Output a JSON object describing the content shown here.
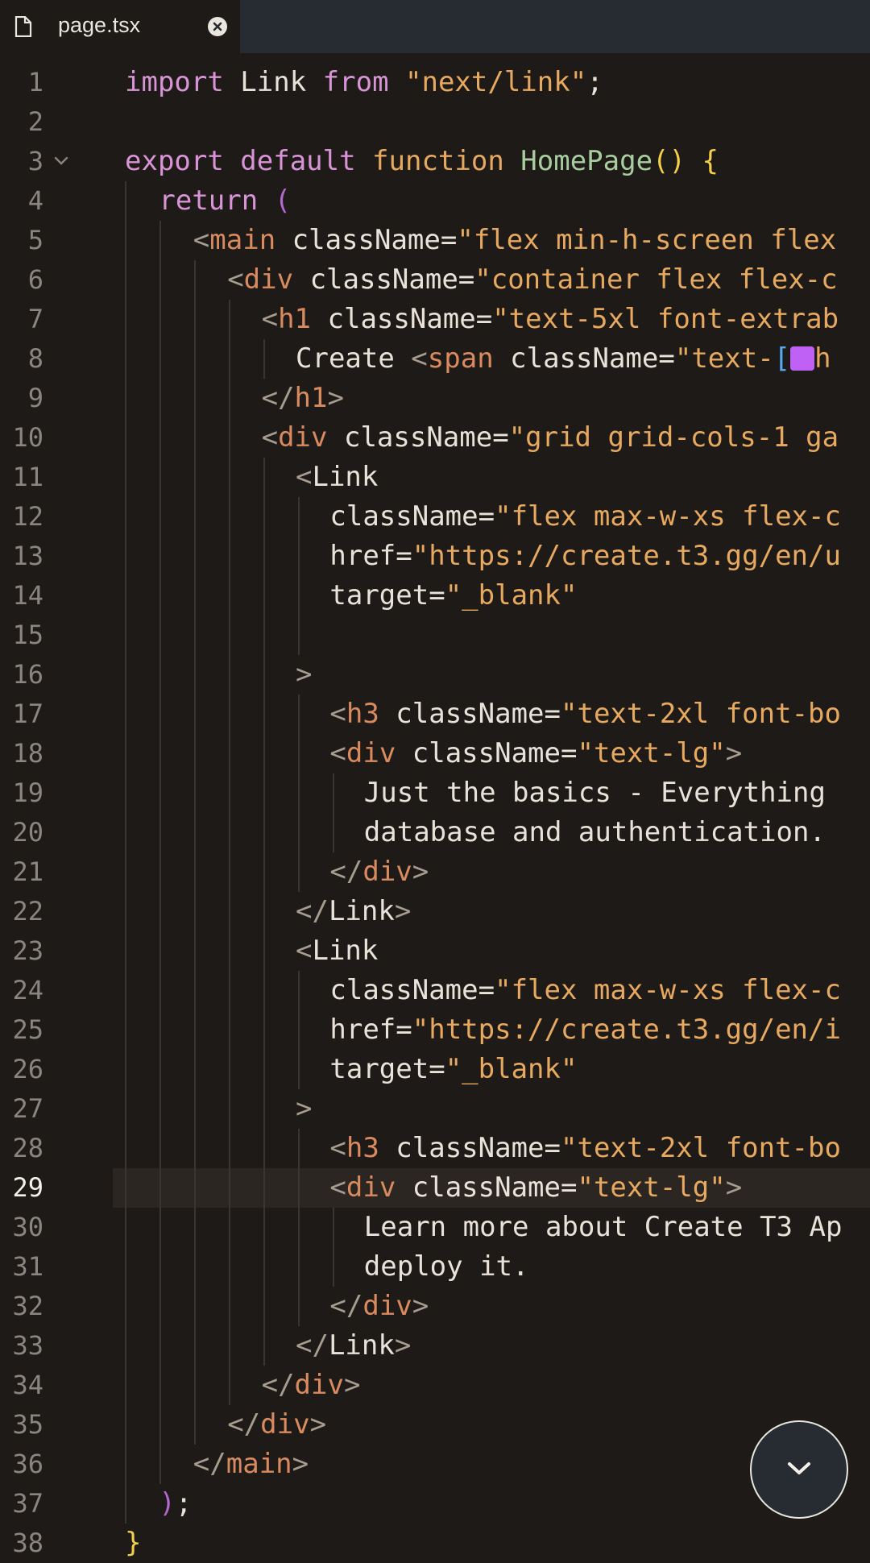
{
  "tab": {
    "title": "page.tsx"
  },
  "current_line": 29,
  "icons": {
    "file": "file-icon",
    "close": "close-icon",
    "scroll": "chevron-down-icon",
    "fold": "fold-chevron-icon"
  },
  "colors": {
    "background": "#1e1a17",
    "tab_bar": "#262c31",
    "keyword": "#d894d6",
    "string": "#e7a95f",
    "function": "#a8cd9f",
    "bracket": "#f2d04a",
    "swatch": "#c061f5"
  },
  "lines": [
    {
      "n": "1",
      "tokens": [
        {
          "c": "k",
          "t": "import"
        },
        {
          "c": "t",
          "t": " Link "
        },
        {
          "c": "k",
          "t": "from"
        },
        {
          "c": "s",
          "t": " \"next/link\""
        },
        {
          "c": "t",
          "t": ";"
        }
      ]
    },
    {
      "n": "2",
      "tokens": []
    },
    {
      "n": "3",
      "tokens": [
        {
          "c": "k",
          "t": "export default "
        },
        {
          "c": "s",
          "t": "function "
        },
        {
          "c": "f",
          "t": "HomePage"
        },
        {
          "c": "b",
          "t": "() {"
        }
      ]
    },
    {
      "n": "4",
      "tokens": [
        {
          "c": "k",
          "t": "return "
        },
        {
          "c": "m",
          "t": "("
        }
      ]
    },
    {
      "n": "5",
      "tokens": [
        {
          "c": "p",
          "t": "<"
        },
        {
          "c": "tag",
          "t": "main"
        },
        {
          "c": "t",
          "t": " className="
        },
        {
          "c": "s",
          "t": "\"flex min-h-screen flex"
        }
      ]
    },
    {
      "n": "6",
      "tokens": [
        {
          "c": "p",
          "t": "<"
        },
        {
          "c": "tag",
          "t": "div"
        },
        {
          "c": "t",
          "t": " className="
        },
        {
          "c": "s",
          "t": "\"container flex flex-c"
        }
      ]
    },
    {
      "n": "7",
      "tokens": [
        {
          "c": "p",
          "t": "<"
        },
        {
          "c": "tag",
          "t": "h1"
        },
        {
          "c": "t",
          "t": " className="
        },
        {
          "c": "s",
          "t": "\"text-5xl font-extrab"
        }
      ]
    },
    {
      "n": "8",
      "tokens": [
        {
          "c": "t",
          "t": "Create "
        },
        {
          "c": "p",
          "t": "<"
        },
        {
          "c": "tag",
          "t": "span"
        },
        {
          "c": "t",
          "t": " className="
        },
        {
          "c": "s",
          "t": "\"text-"
        },
        {
          "c": "bl",
          "t": "["
        },
        {
          "c": "swatch",
          "t": ""
        },
        {
          "c": "s",
          "t": "h"
        }
      ]
    },
    {
      "n": "9",
      "tokens": [
        {
          "c": "p",
          "t": "</"
        },
        {
          "c": "tag",
          "t": "h1"
        },
        {
          "c": "p",
          "t": ">"
        }
      ]
    },
    {
      "n": "10",
      "tokens": [
        {
          "c": "p",
          "t": "<"
        },
        {
          "c": "tag",
          "t": "div"
        },
        {
          "c": "t",
          "t": " className="
        },
        {
          "c": "s",
          "t": "\"grid grid-cols-1 ga"
        }
      ]
    },
    {
      "n": "11",
      "tokens": [
        {
          "c": "p",
          "t": "<"
        },
        {
          "c": "t",
          "t": "Link"
        }
      ]
    },
    {
      "n": "12",
      "tokens": [
        {
          "c": "t",
          "t": "className="
        },
        {
          "c": "s",
          "t": "\"flex max-w-xs flex-c"
        }
      ]
    },
    {
      "n": "13",
      "tokens": [
        {
          "c": "t",
          "t": "href="
        },
        {
          "c": "s",
          "t": "\"https://create.t3.gg/en/u"
        }
      ]
    },
    {
      "n": "14",
      "tokens": [
        {
          "c": "t",
          "t": "target="
        },
        {
          "c": "s",
          "t": "\"_blank\""
        }
      ]
    },
    {
      "n": "15",
      "tokens": []
    },
    {
      "n": "16",
      "tokens": [
        {
          "c": "p",
          "t": ">"
        }
      ]
    },
    {
      "n": "17",
      "tokens": [
        {
          "c": "p",
          "t": "<"
        },
        {
          "c": "tag",
          "t": "h3"
        },
        {
          "c": "t",
          "t": " className="
        },
        {
          "c": "s",
          "t": "\"text-2xl font-bo"
        }
      ]
    },
    {
      "n": "18",
      "tokens": [
        {
          "c": "p",
          "t": "<"
        },
        {
          "c": "tag",
          "t": "div"
        },
        {
          "c": "t",
          "t": " className="
        },
        {
          "c": "s",
          "t": "\"text-lg\""
        },
        {
          "c": "p",
          "t": ">"
        }
      ]
    },
    {
      "n": "19",
      "tokens": [
        {
          "c": "t",
          "t": "Just the basics - Everything"
        }
      ]
    },
    {
      "n": "20",
      "tokens": [
        {
          "c": "t",
          "t": "database and authentication."
        }
      ]
    },
    {
      "n": "21",
      "tokens": [
        {
          "c": "p",
          "t": "</"
        },
        {
          "c": "tag",
          "t": "div"
        },
        {
          "c": "p",
          "t": ">"
        }
      ]
    },
    {
      "n": "22",
      "tokens": [
        {
          "c": "p",
          "t": "</"
        },
        {
          "c": "t",
          "t": "Link"
        },
        {
          "c": "p",
          "t": ">"
        }
      ]
    },
    {
      "n": "23",
      "tokens": [
        {
          "c": "p",
          "t": "<"
        },
        {
          "c": "t",
          "t": "Link"
        }
      ]
    },
    {
      "n": "24",
      "tokens": [
        {
          "c": "t",
          "t": "className="
        },
        {
          "c": "s",
          "t": "\"flex max-w-xs flex-c"
        }
      ]
    },
    {
      "n": "25",
      "tokens": [
        {
          "c": "t",
          "t": "href="
        },
        {
          "c": "s",
          "t": "\"https://create.t3.gg/en/i"
        }
      ]
    },
    {
      "n": "26",
      "tokens": [
        {
          "c": "t",
          "t": "target="
        },
        {
          "c": "s",
          "t": "\"_blank\""
        }
      ]
    },
    {
      "n": "27",
      "tokens": [
        {
          "c": "p",
          "t": ">"
        }
      ]
    },
    {
      "n": "28",
      "tokens": [
        {
          "c": "p",
          "t": "<"
        },
        {
          "c": "tag",
          "t": "h3"
        },
        {
          "c": "t",
          "t": " className="
        },
        {
          "c": "s",
          "t": "\"text-2xl font-bo"
        }
      ]
    },
    {
      "n": "29",
      "tokens": [
        {
          "c": "p",
          "t": "<"
        },
        {
          "c": "tag",
          "t": "div"
        },
        {
          "c": "t",
          "t": " className="
        },
        {
          "c": "s",
          "t": "\"text-lg\""
        },
        {
          "c": "p",
          "t": ">"
        }
      ]
    },
    {
      "n": "30",
      "tokens": [
        {
          "c": "t",
          "t": "Learn more about Create T3 Ap"
        }
      ]
    },
    {
      "n": "31",
      "tokens": [
        {
          "c": "t",
          "t": "deploy it."
        }
      ]
    },
    {
      "n": "32",
      "tokens": [
        {
          "c": "p",
          "t": "</"
        },
        {
          "c": "tag",
          "t": "div"
        },
        {
          "c": "p",
          "t": ">"
        }
      ]
    },
    {
      "n": "33",
      "tokens": [
        {
          "c": "p",
          "t": "</"
        },
        {
          "c": "t",
          "t": "Link"
        },
        {
          "c": "p",
          "t": ">"
        }
      ]
    },
    {
      "n": "34",
      "tokens": [
        {
          "c": "p",
          "t": "</"
        },
        {
          "c": "tag",
          "t": "div"
        },
        {
          "c": "p",
          "t": ">"
        }
      ]
    },
    {
      "n": "35",
      "tokens": [
        {
          "c": "p",
          "t": "</"
        },
        {
          "c": "tag",
          "t": "div"
        },
        {
          "c": "p",
          "t": ">"
        }
      ]
    },
    {
      "n": "36",
      "tokens": [
        {
          "c": "p",
          "t": "</"
        },
        {
          "c": "tag",
          "t": "main"
        },
        {
          "c": "p",
          "t": ">"
        }
      ]
    },
    {
      "n": "37",
      "tokens": [
        {
          "c": "m",
          "t": ")"
        },
        {
          "c": "t",
          "t": ";"
        }
      ]
    },
    {
      "n": "38",
      "tokens": [
        {
          "c": "b",
          "t": "}"
        }
      ]
    }
  ]
}
